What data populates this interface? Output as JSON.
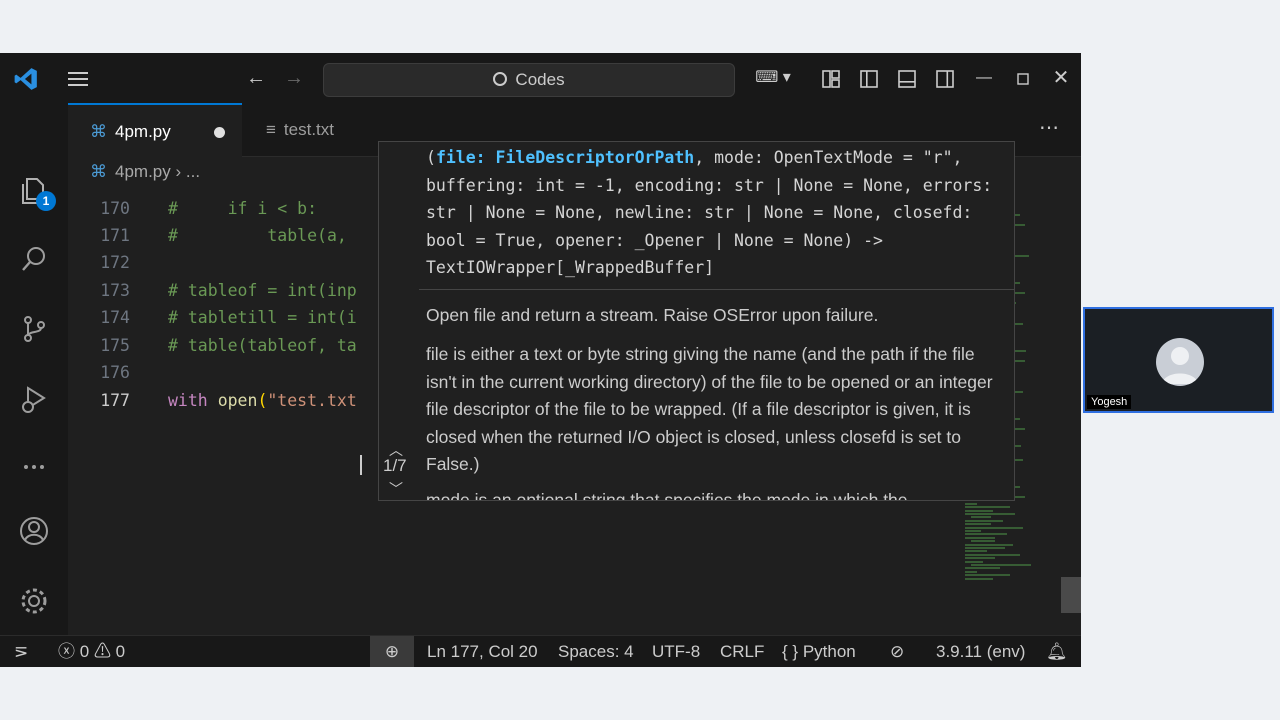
{
  "titlebar": {
    "search_text": "Codes",
    "icons": [
      "vscode-logo-icon",
      "menu-icon",
      "back-icon",
      "forward-icon",
      "copilot-icon",
      "layout-icon",
      "toggle-sidebar-icon",
      "toggle-panel-icon",
      "toggle-secondary-sidebar-icon",
      "minimize-icon",
      "maximize-icon",
      "close-icon"
    ]
  },
  "activitybar": {
    "explorer_badge": "1"
  },
  "tabs": [
    {
      "label": "4pm.py",
      "active": true,
      "modified": true
    },
    {
      "label": "test.txt",
      "active": false
    }
  ],
  "breadcrumb": {
    "file": "4pm.py",
    "more": "..."
  },
  "editor": {
    "lines": [
      {
        "num": "170",
        "text": "#     if i < b:"
      },
      {
        "num": "171",
        "text": "#         table(a,"
      },
      {
        "num": "172",
        "text": ""
      },
      {
        "num": "173",
        "text": "# tableof = int(inp"
      },
      {
        "num": "174",
        "text": "# tabletill = int(i"
      },
      {
        "num": "175",
        "text": "# table(tableof, ta"
      },
      {
        "num": "176",
        "text": ""
      },
      {
        "num": "177",
        "kw": "with",
        "fn": "open",
        "paren": "(",
        "str": "\"test.txt"
      }
    ]
  },
  "hover": {
    "nav_count": "1/7",
    "sig_open": "(",
    "sig_param": "file: FileDescriptorOrPath",
    "sig_rest": ", mode: OpenTextMode = \"r\", buffering: int = -1, encoding: str | None = None, errors: str | None = None, newline: str | None = None, closefd: bool = True, opener: _Opener | None = None) -> TextIOWrapper[_WrappedBuffer]",
    "doc_summary": "Open file and return a stream. Raise OSError upon failure.",
    "doc_body": "file is either a text or byte string giving the name (and the path if the file isn't in the current working directory) of the file to be opened or an integer file descriptor of the file to be wrapped. (If a file descriptor is given, it is closed when the returned I/O object is closed, unless closefd is set to False.)",
    "doc_cut": "mode is an optional string that specifies the mode in which the"
  },
  "statusbar": {
    "errors": "0",
    "warnings": "0",
    "position": "Ln 177, Col 20",
    "spaces": "Spaces: 4",
    "encoding": "UTF-8",
    "eol": "CRLF",
    "language_braces": "{ }",
    "language": "Python",
    "interpreter": "3.9.11 (env)"
  },
  "webcam": {
    "name": "Yogesh"
  }
}
